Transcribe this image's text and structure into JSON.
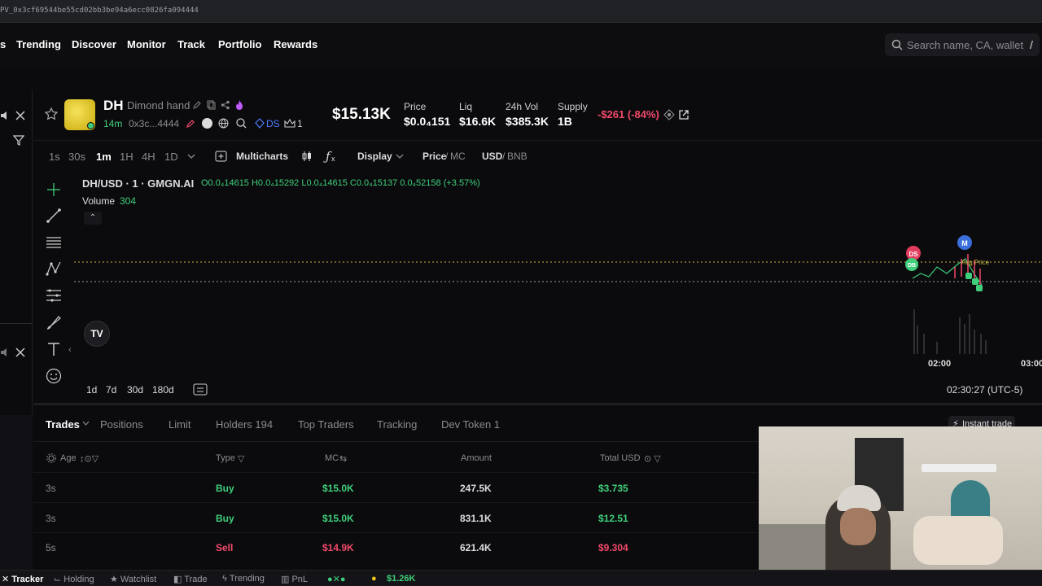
{
  "browser": {
    "url_fragment": "PV_0x3cf69544be55cd02bb3be94a6ecc0826fa094444"
  },
  "nav": {
    "items": [
      "Trending",
      "Discover",
      "Monitor",
      "Track",
      "Portfolio",
      "Rewards"
    ],
    "search_placeholder": "Search name, CA, wallet",
    "search_shortcut": "/"
  },
  "token": {
    "symbol": "DH",
    "name": "Dimond hand",
    "age": "14m",
    "address": "0x3c...4444",
    "ds_tag": "DS",
    "holders_badge": "1",
    "market_cap": "$15.13K",
    "price_label": "Price",
    "price_value": "$0.0₄151",
    "liq_label": "Liq",
    "liq_value": "$16.6K",
    "vol_label": "24h Vol",
    "vol_value": "$385.3K",
    "supply_label": "Supply",
    "supply_value": "1B",
    "change": "-$261 (-84%)"
  },
  "timeframes": {
    "items": [
      "1s",
      "30s",
      "1m",
      "1H",
      "4H",
      "1D"
    ],
    "active": "1m"
  },
  "toolbar": {
    "multicharts": "Multicharts",
    "display": "Display",
    "price": "Price",
    "mc": "MC",
    "usd": "USD",
    "bnb": "BNB"
  },
  "chart": {
    "pair_label": "DH/USD · 1 · GMGN.AI",
    "ohlc": "O0.0₄14615 H0.0₄15292 L0.0₄14615 C0.0₄15137 0.0₄52158 (+3.57%)",
    "volume_label": "Volume",
    "volume_value": "304",
    "x_tick_1": "02:00",
    "x_tick_2": "03:00",
    "clock": "02:30:27 (UTC-5)",
    "markers": [
      "DS",
      "DB",
      "M"
    ],
    "price_tag": "Avg Price",
    "ranges": [
      "1d",
      "7d",
      "30d",
      "180d"
    ]
  },
  "trades": {
    "tabs": [
      "Trades",
      "Positions",
      "Limit",
      "Holders 194",
      "Top Traders",
      "Tracking",
      "Dev Token 1"
    ],
    "instant_trade": "Instant trade",
    "columns": [
      "Age",
      "Type",
      "MC",
      "Amount",
      "Total USD"
    ],
    "rows": [
      {
        "age": "3s",
        "type": "Buy",
        "mc": "$15.0K",
        "amount": "247.5K",
        "total": "$3.735"
      },
      {
        "age": "3s",
        "type": "Buy",
        "mc": "$15.0K",
        "amount": "831.1K",
        "total": "$12.51"
      },
      {
        "age": "5s",
        "type": "Sell",
        "mc": "$14.9K",
        "amount": "621.4K",
        "total": "$9.304"
      }
    ]
  },
  "bottombar": {
    "items": [
      "Tracker",
      "Holding",
      "Watchlist",
      "Trade",
      "Trending",
      "PnL"
    ],
    "balance": "$1.26K"
  },
  "colors": {
    "green": "#3fcf7a",
    "red": "#f2496a",
    "accent_blue": "#4f7cff"
  }
}
